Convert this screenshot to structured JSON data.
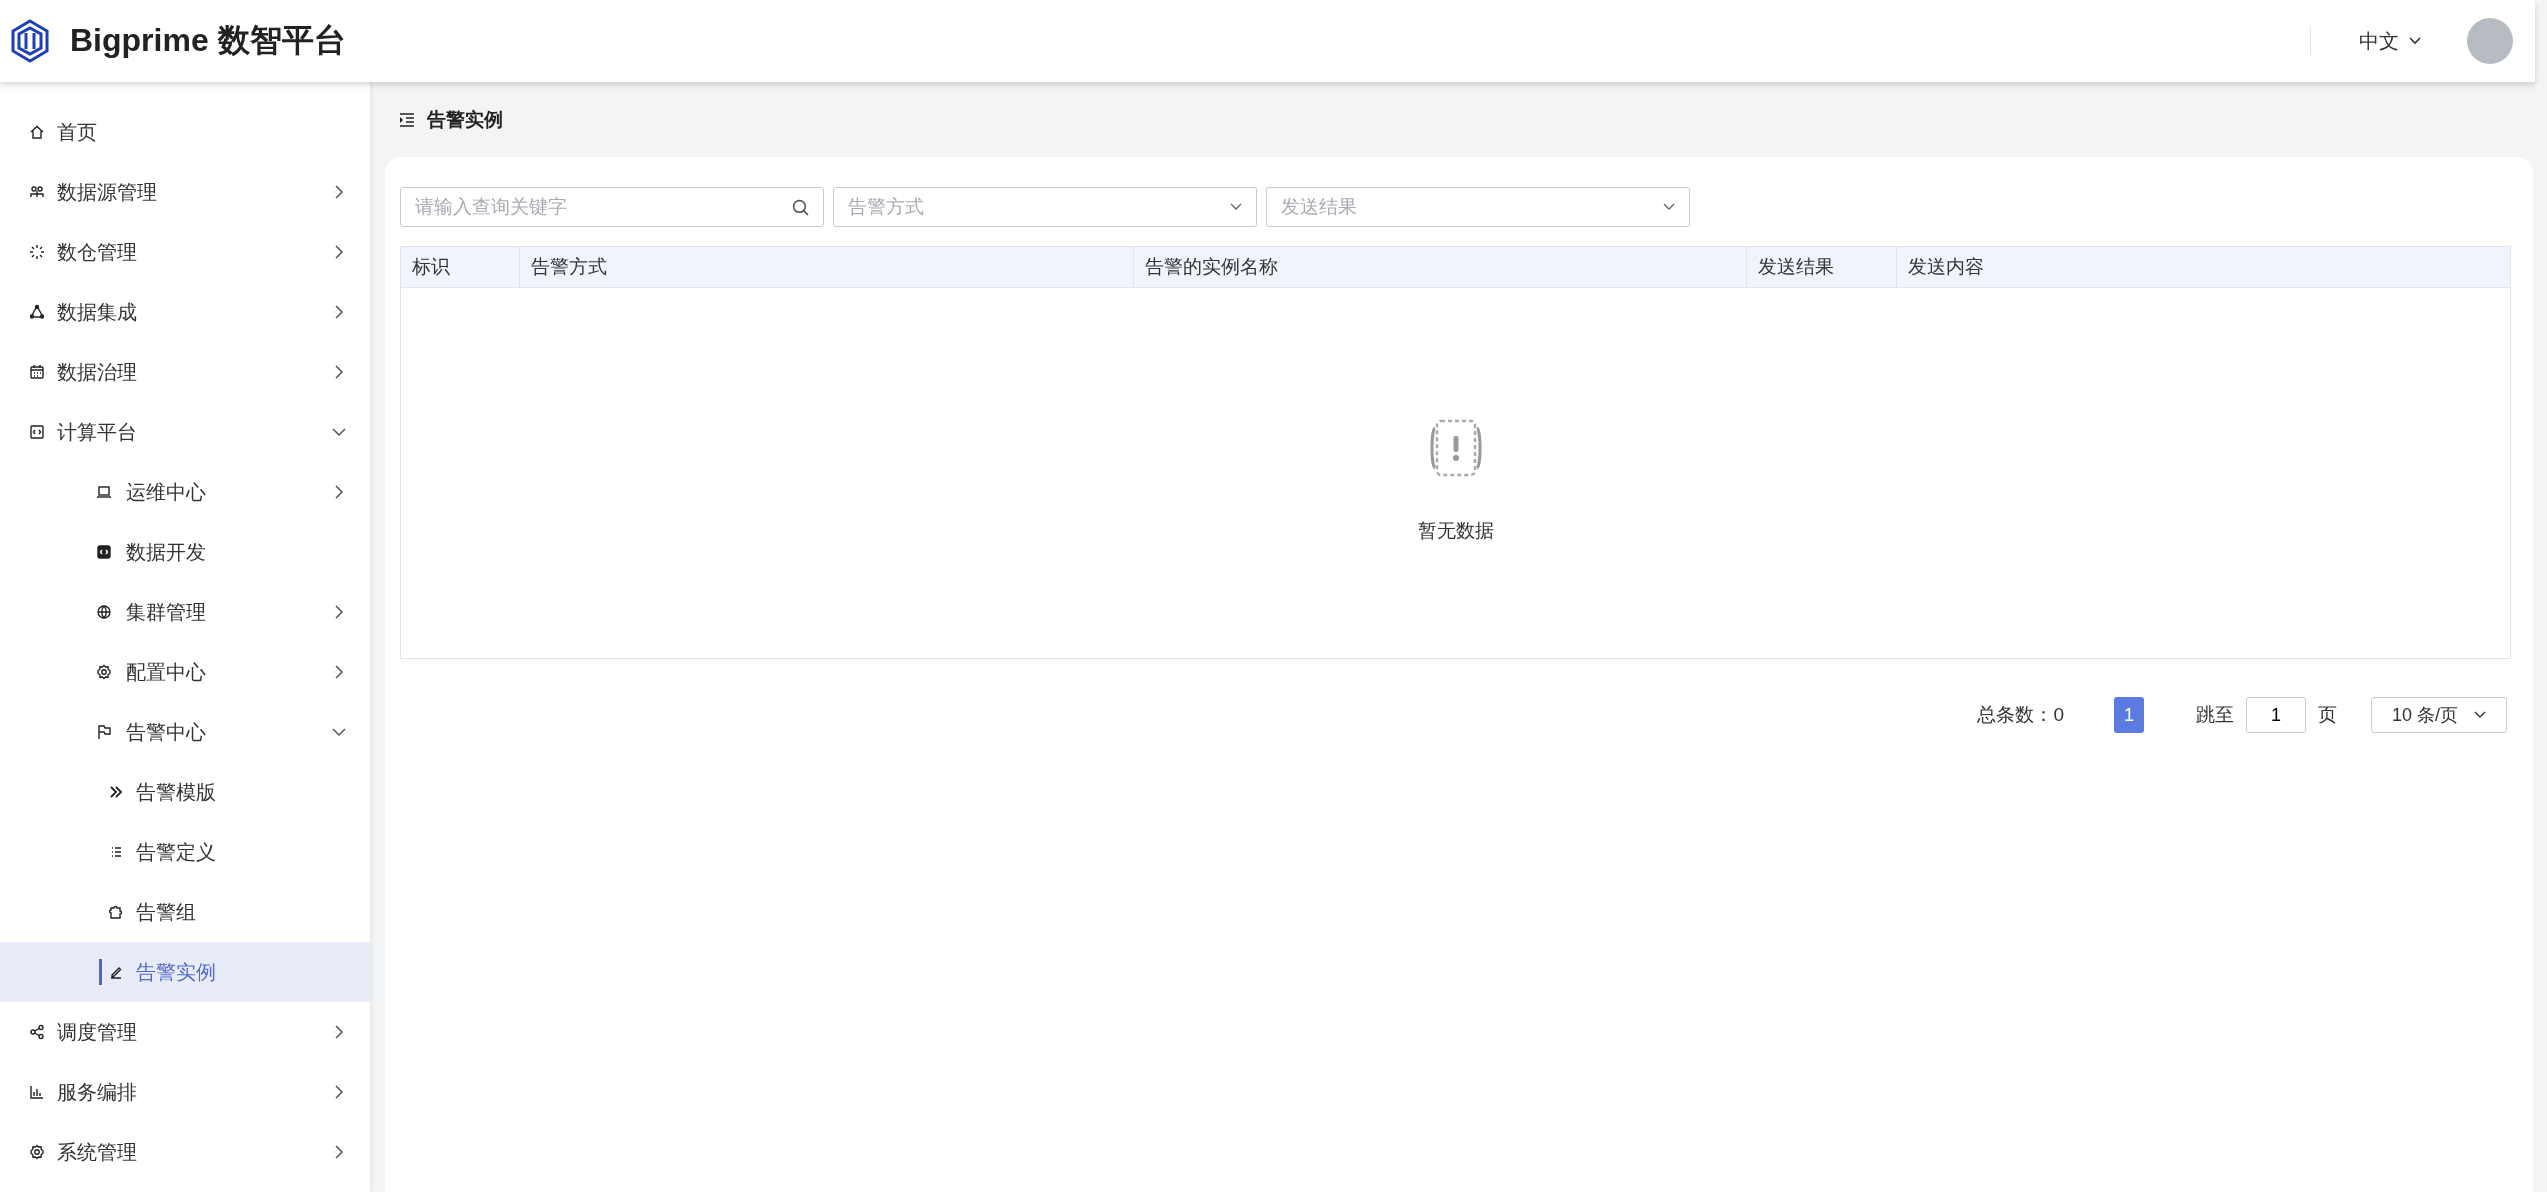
{
  "header": {
    "brand": "Bigprime 数智平台",
    "language": "中文"
  },
  "sidebar": {
    "items": [
      {
        "label": "首页",
        "selected": false
      },
      {
        "label": "数据源管理",
        "expanded": false,
        "selected": false
      },
      {
        "label": "数仓管理",
        "expanded": false,
        "selected": false
      },
      {
        "label": "数据集成",
        "expanded": false,
        "selected": false
      },
      {
        "label": "数据治理",
        "expanded": false,
        "selected": false
      },
      {
        "label": "计算平台",
        "expanded": true,
        "selected": false,
        "children": [
          {
            "label": "运维中心",
            "expanded": false,
            "selected": false
          },
          {
            "label": "数据开发",
            "selected": false
          },
          {
            "label": "集群管理",
            "expanded": false,
            "selected": false
          },
          {
            "label": "配置中心",
            "expanded": false,
            "selected": false
          },
          {
            "label": "告警中心",
            "expanded": true,
            "selected": false,
            "children": [
              {
                "label": "告警模版",
                "selected": false
              },
              {
                "label": "告警定义",
                "selected": false
              },
              {
                "label": "告警组",
                "selected": false
              },
              {
                "label": "告警实例",
                "selected": true
              }
            ]
          }
        ]
      },
      {
        "label": "调度管理",
        "expanded": false,
        "selected": false
      },
      {
        "label": "服务编排",
        "expanded": false,
        "selected": false
      },
      {
        "label": "系统管理",
        "expanded": false,
        "selected": false
      }
    ]
  },
  "breadcrumb": "告警实例",
  "filters": {
    "search": {
      "placeholder": "请输入查询关键字"
    },
    "selects": [
      {
        "placeholder": "告警方式"
      },
      {
        "placeholder": "发送结果"
      }
    ]
  },
  "table": {
    "columns": [
      "标识",
      "告警方式",
      "告警的实例名称",
      "发送结果",
      "发送内容"
    ],
    "empty_text": "暂无数据"
  },
  "pagination": {
    "total": "总条数：0",
    "pages": [
      {
        "label": "1",
        "selected": true
      }
    ],
    "jump_label": "跳至",
    "jump_value": "1",
    "jump_suffix": "页",
    "page_size": "10 条/页"
  }
}
